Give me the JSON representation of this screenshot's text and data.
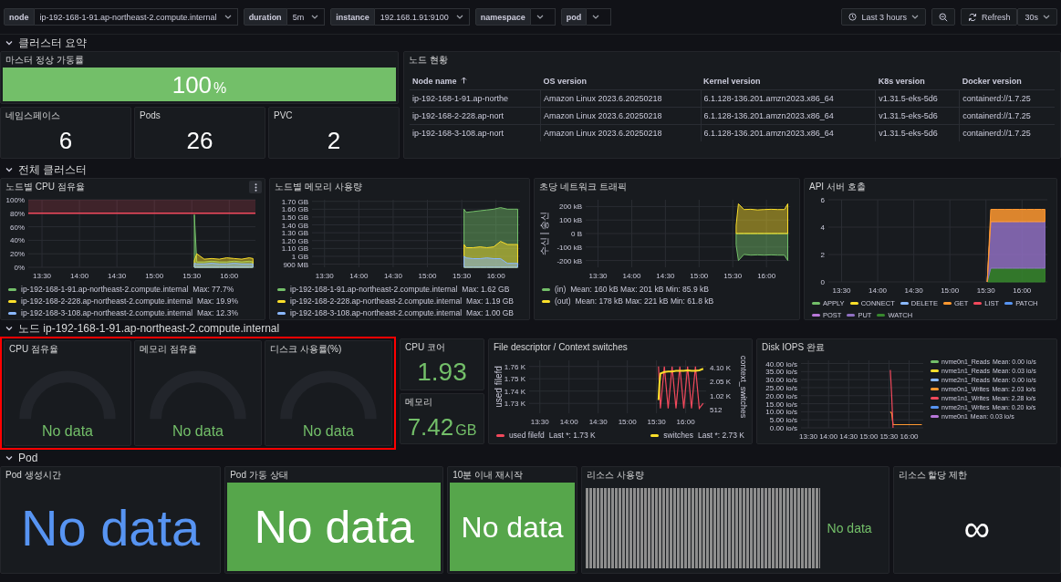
{
  "toolbar": {
    "variables": [
      {
        "label": "node",
        "value": "ip-192-168-1-91.ap-northeast-2.compute.internal"
      },
      {
        "label": "duration",
        "value": "5m"
      },
      {
        "label": "instance",
        "value": "192.168.1.91:9100"
      },
      {
        "label": "namespace"
      },
      {
        "label": "pod"
      }
    ],
    "time_range": "Last 3 hours",
    "refresh": "Refresh",
    "refresh_interval": "30s"
  },
  "rows": [
    {
      "title": "클러스터 요약",
      "expanded": true,
      "panels": [
        {
          "kind": "stat",
          "title": "마스터 정상 가동률",
          "value": "100",
          "unit": "%",
          "background": true,
          "color": "#73bf69"
        },
        {
          "kind": "stat",
          "title": "네임스페이스",
          "value": "6",
          "background": false,
          "color": "#ffffff"
        },
        {
          "kind": "stat",
          "title": "Pods",
          "value": "26",
          "background": false,
          "color": "#ffffff"
        },
        {
          "kind": "stat",
          "title": "PVC",
          "value": "2",
          "background": false,
          "color": "#ffffff"
        },
        {
          "kind": "table",
          "title": "노드 현황",
          "columns": [
            {
              "label": "Node name",
              "sort_ascending": true
            },
            {
              "label": "OS version",
              "sort_ascending": false
            },
            {
              "label": "Kernel version",
              "sort_ascending": false
            },
            {
              "label": "K8s version",
              "sort_ascending": false
            },
            {
              "label": "Docker version",
              "sort_ascending": false
            }
          ],
          "rows": [
            [
              "ip-192-168-1-91.ap-northe",
              "Amazon Linux 2023.6.20250218",
              "6.1.128-136.201.amzn2023.x86_64",
              "v1.31.5-eks-5d6",
              "containerd://1.7.25"
            ],
            [
              "ip-192-168-2-228.ap-nort",
              "Amazon Linux 2023.6.20250218",
              "6.1.128-136.201.amzn2023.x86_64",
              "v1.31.5-eks-5d6",
              "containerd://1.7.25"
            ],
            [
              "ip-192-168-3-108.ap-nort",
              "Amazon Linux 2023.6.20250218",
              "6.1.128-136.201.amzn2023.x86_64",
              "v1.31.5-eks-5d6",
              "containerd://1.7.25"
            ]
          ]
        }
      ]
    },
    {
      "title": "전체 클러스터",
      "expanded": true,
      "panels": [
        {
          "kind": "timeseries",
          "title": "노드별 CPU 점유율",
          "menu": true,
          "legend_stats": [
            "Max: 77.7%",
            "Max: 19.9%",
            "Max: 12.3%"
          ],
          "chart_data": {
            "type": "area",
            "grid": true,
            "x": [
              932,
              934,
              940,
              946,
              952,
              958,
              964,
              970,
              976,
              979
            ],
            "xlim": [
              799,
              981
            ],
            "ylim": [
              0,
              100
            ],
            "xticks": [
              {
                "value": 810,
                "label": "13:30"
              },
              {
                "value": 840,
                "label": "14:00"
              },
              {
                "value": 870,
                "label": "14:30"
              },
              {
                "value": 900,
                "label": "15:00"
              },
              {
                "value": 930,
                "label": "15:30"
              },
              {
                "value": 960,
                "label": "16:00"
              }
            ],
            "yticks": [
              {
                "value": 0,
                "label": "0%"
              },
              {
                "value": 20,
                "label": "20%"
              },
              {
                "value": 40,
                "label": "40%"
              },
              {
                "value": 60,
                "label": "60%"
              },
              {
                "value": 80,
                "label": "80%"
              },
              {
                "value": 100,
                "label": "100%"
              }
            ],
            "ref_lines": [
              {
                "axis": "y",
                "value": 80,
                "color": "#f2495c"
              }
            ],
            "bands": [
              {
                "axis": "y",
                "from": 80,
                "to": 100,
                "color": "#f2495c"
              }
            ],
            "series": [
              {
                "name": "ip-192-168-1-91.ap-northeast-2.compute.internal",
                "color": "#73bf69",
                "values": [
                  78,
                  8,
                  8,
                  9,
                  8,
                  8,
                  9,
                  8,
                  9,
                  8
                ]
              },
              {
                "name": "ip-192-168-2-228.ap-northeast-2.compute.internal",
                "color": "#fade2a",
                "values": [
                  10,
                  20,
                  12,
                  13,
                  12,
                  14,
                  13,
                  12,
                  14,
                  13
                ]
              },
              {
                "name": "ip-192-168-3-108.ap-northeast-2.compute.internal",
                "color": "#8ab8ff",
                "values": [
                  6,
                  5,
                  5,
                  6,
                  5,
                  5,
                  6,
                  5,
                  5,
                  5
                ]
              }
            ]
          }
        },
        {
          "kind": "timeseries",
          "title": "노드별 메모리 사용량",
          "legend_stats": [
            "Max: 1.62 GB",
            "Max: 1.19 GB",
            "Max: 1.00 GB"
          ],
          "lower_tick_label": "900 MB",
          "chart_data": {
            "type": "area",
            "grid": true,
            "x": [
              932,
              934,
              940,
              946,
              952,
              958,
              964,
              970,
              976,
              979
            ],
            "xlim": [
              799,
              981
            ],
            "ylim": [
              0.86,
              1.72
            ],
            "xticks": [
              {
                "value": 810,
                "label": "13:30"
              },
              {
                "value": 840,
                "label": "14:00"
              },
              {
                "value": 870,
                "label": "14:30"
              },
              {
                "value": 900,
                "label": "15:00"
              },
              {
                "value": 930,
                "label": "15:30"
              },
              {
                "value": 960,
                "label": "16:00"
              }
            ],
            "yticks": [
              {
                "value": 1.0,
                "label": "1 GB"
              },
              {
                "value": 1.1,
                "label": "1.10 GB"
              },
              {
                "value": 1.2,
                "label": "1.20 GB"
              },
              {
                "value": 1.3,
                "label": "1.30 GB"
              },
              {
                "value": 1.4,
                "label": "1.40 GB"
              },
              {
                "value": 1.5,
                "label": "1.50 GB"
              },
              {
                "value": 1.6,
                "label": "1.60 GB"
              },
              {
                "value": 1.7,
                "label": "1.70 GB"
              }
            ],
            "series": [
              {
                "name": "ip-192-168-1-91.ap-northeast-2.compute.internal",
                "color": "#73bf69",
                "values": [
                  1.6,
                  1.56,
                  1.57,
                  1.58,
                  1.59,
                  1.6,
                  1.62,
                  1.6,
                  1.6,
                  1.6
                ]
              },
              {
                "name": "ip-192-168-2-228.ap-northeast-2.compute.internal",
                "color": "#fade2a",
                "values": [
                  1.15,
                  1.11,
                  1.11,
                  1.12,
                  1.11,
                  1.12,
                  1.19,
                  1.15,
                  1.15,
                  1.15
                ]
              },
              {
                "name": "ip-192-168-3-108.ap-northeast-2.compute.internal",
                "color": "#8ab8ff",
                "values": [
                  1.0,
                  0.98,
                  0.97,
                  0.97,
                  0.98,
                  0.97,
                  0.97,
                  0.91,
                  0.91,
                  0.91
                ]
              }
            ]
          }
        },
        {
          "kind": "timeseries",
          "title": "초당 네트워크 트래픽",
          "legend_stats": [
            "Mean: 160 kB  Max: 201 kB  Min: 85.9 kB",
            "Mean: 178 kB  Max: 221 kB  Min: 61.8 kB"
          ],
          "chart_data": {
            "type": "area",
            "grid": true,
            "ylabel": "수신 | 송신",
            "x": [
              933,
              935,
              940,
              946,
              952,
              958,
              964,
              970,
              976,
              979
            ],
            "xlim": [
              799,
              981
            ],
            "ylim": [
              -250,
              250
            ],
            "xticks": [
              {
                "value": 810,
                "label": "13:30"
              },
              {
                "value": 840,
                "label": "14:00"
              },
              {
                "value": 870,
                "label": "14:30"
              },
              {
                "value": 900,
                "label": "15:00"
              },
              {
                "value": 930,
                "label": "15:30"
              },
              {
                "value": 960,
                "label": "16:00"
              }
            ],
            "yticks": [
              {
                "value": -200,
                "label": "-200 kB"
              },
              {
                "value": -100,
                "label": "-100 kB"
              },
              {
                "value": 0,
                "label": "0 B"
              },
              {
                "value": 100,
                "label": "100 kB"
              },
              {
                "value": 200,
                "label": "200 kB"
              }
            ],
            "series": [
              {
                "name": "(in)",
                "color": "#73bf69",
                "values": [
                  -85,
                  -200,
                  -155,
                  -160,
                  -158,
                  -160,
                  -158,
                  -160,
                  -160,
                  -200
                ]
              },
              {
                "name": "(out)",
                "color": "#fade2a",
                "values": [
                  60,
                  220,
                  178,
                  180,
                  175,
                  178,
                  180,
                  178,
                  178,
                  220
                ]
              }
            ]
          }
        },
        {
          "kind": "timeseries",
          "title": "API 서버 호출",
          "chart_data": {
            "type": "area",
            "grid": true,
            "stacked": true,
            "x": [
              931,
              934,
              940,
              946,
              952,
              958,
              964,
              970,
              976,
              979
            ],
            "xlim": [
              799,
              981
            ],
            "ylim": [
              0,
              6
            ],
            "xticks": [
              {
                "value": 810,
                "label": "13:30"
              },
              {
                "value": 840,
                "label": "14:00"
              },
              {
                "value": 870,
                "label": "14:30"
              },
              {
                "value": 900,
                "label": "15:00"
              },
              {
                "value": 930,
                "label": "15:30"
              },
              {
                "value": 960,
                "label": "16:00"
              }
            ],
            "yticks": [
              {
                "value": 0,
                "label": "0"
              },
              {
                "value": 2,
                "label": "2"
              },
              {
                "value": 4,
                "label": "4"
              },
              {
                "value": 6,
                "label": "6"
              }
            ],
            "series": [
              {
                "name": "WATCH",
                "color": "#37872d",
                "values": [
                  0,
                  1.0,
                  1.0,
                  1.0,
                  1.0,
                  1.0,
                  1.0,
                  1.0,
                  1.0,
                  1.0
                ]
              },
              {
                "name": "PUT",
                "color": "#8f6fc1",
                "values": [
                  0,
                  3.4,
                  3.4,
                  3.4,
                  3.4,
                  3.4,
                  3.4,
                  3.4,
                  3.4,
                  3.4
                ]
              },
              {
                "name": "GET",
                "color": "#ff9830",
                "values": [
                  0,
                  0.9,
                  0.9,
                  0.9,
                  0.9,
                  0.9,
                  0.9,
                  0.9,
                  0.9,
                  0.9
                ]
              },
              {
                "name": "APPLY",
                "color": "#73bf69",
                "values": [
                  null,
                  null,
                  null,
                  null,
                  null,
                  null,
                  null,
                  null,
                  null,
                  null
                ]
              },
              {
                "name": "CONNECT",
                "color": "#fade2a",
                "values": [
                  null,
                  null,
                  null,
                  null,
                  null,
                  null,
                  null,
                  null,
                  null,
                  null
                ]
              },
              {
                "name": "DELETE",
                "color": "#8ab8ff",
                "values": [
                  null,
                  null,
                  null,
                  null,
                  null,
                  null,
                  null,
                  null,
                  null,
                  null
                ]
              },
              {
                "name": "LIST",
                "color": "#f2495c",
                "values": [
                  null,
                  null,
                  null,
                  null,
                  null,
                  null,
                  null,
                  null,
                  null,
                  null
                ]
              },
              {
                "name": "PATCH",
                "color": "#5794f2",
                "values": [
                  null,
                  null,
                  null,
                  null,
                  null,
                  null,
                  null,
                  null,
                  null,
                  null
                ]
              },
              {
                "name": "POST",
                "color": "#b877d9",
                "values": [
                  null,
                  null,
                  null,
                  null,
                  null,
                  null,
                  null,
                  null,
                  null,
                  null
                ]
              }
            ]
          }
        }
      ]
    },
    {
      "title": "노드 ip-192-168-1-91.ap-northeast-2.compute.internal",
      "expanded": true,
      "highlighted": true,
      "panels": [
        {
          "kind": "gauge",
          "title": "CPU 점유율",
          "value": "No data",
          "color": "#73bf69"
        },
        {
          "kind": "gauge",
          "title": "메모리 점유율",
          "value": "No data",
          "color": "#73bf69"
        },
        {
          "kind": "gauge",
          "title": "디스크 사용률(%)",
          "value": "No data",
          "color": "#73bf69"
        },
        {
          "kind": "stat",
          "title": "CPU 코어",
          "value": "1.93",
          "background": false,
          "color": "#73bf69"
        },
        {
          "kind": "stat",
          "title": "메모리",
          "value": "7.42",
          "unit": "GB",
          "background": false,
          "color": "#73bf69"
        },
        {
          "kind": "timeseries",
          "title": "File descriptor / Context switches",
          "legend_stats": [
            "Last *: 1.73 K",
            "Last *: 2.73 K"
          ],
          "right_axis": {
            "title": "context_switches",
            "ticks": [
              "4.10 K",
              "2.05 K",
              "1.02 K",
              "512"
            ]
          },
          "secondary_series": {
            "name": "switches",
            "color": "#fade2a"
          },
          "chart_data": {
            "type": "line",
            "grid": true,
            "ylabel": "used filefd",
            "x": [
              932,
              934,
              938,
              942,
              946,
              950,
              954,
              958,
              962,
              966,
              970,
              974,
              978
            ],
            "xlim": [
              799,
              981
            ],
            "ylim": [
              1.722,
              1.765
            ],
            "xticks": [
              {
                "value": 810,
                "label": "13:30"
              },
              {
                "value": 840,
                "label": "14:00"
              },
              {
                "value": 870,
                "label": "14:30"
              },
              {
                "value": 900,
                "label": "15:00"
              },
              {
                "value": 930,
                "label": "15:30"
              },
              {
                "value": 960,
                "label": "16:00"
              }
            ],
            "yticks": [
              {
                "value": 1.73,
                "label": "1.73 K"
              },
              {
                "value": 1.74,
                "label": "1.74 K"
              },
              {
                "value": 1.75,
                "label": "1.75 K"
              },
              {
                "value": 1.76,
                "label": "1.76 K"
              }
            ],
            "series": [
              {
                "name": "used filefd",
                "color": "#f2495c",
                "values": [
                  1.76,
                  1.726,
                  1.76,
                  1.726,
                  1.76,
                  1.726,
                  1.76,
                  1.726,
                  1.76,
                  1.726,
                  1.76,
                  1.726,
                  1.73
                ]
              }
            ]
          }
        },
        {
          "kind": "timeseries",
          "title": "Disk IOPS 완료",
          "legend_stats": [
            "Mean: 0.00 io/s",
            "Mean: 0.03 io/s",
            "Mean: 0.00 io/s",
            "Mean: 2.03 io/s",
            "Mean: 2.28 io/s",
            "Mean: 0.20 io/s",
            "Mean: 0.03 io/s"
          ],
          "chart_data": {
            "type": "line",
            "grid": true,
            "x": [
              932,
              934,
              936,
              940,
              946,
              952,
              958,
              964,
              970,
              976,
              979
            ],
            "xlim": [
              799,
              981
            ],
            "ylim": [
              0,
              42
            ],
            "xticks": [
              {
                "value": 810,
                "label": "13:30"
              },
              {
                "value": 840,
                "label": "14:00"
              },
              {
                "value": 870,
                "label": "14:30"
              },
              {
                "value": 900,
                "label": "15:00"
              },
              {
                "value": 930,
                "label": "15:30"
              },
              {
                "value": 960,
                "label": "16:00"
              }
            ],
            "yticks": [
              {
                "value": 0,
                "label": "0.00 io/s"
              },
              {
                "value": 5,
                "label": "5.00 io/s"
              },
              {
                "value": 10,
                "label": "10.00 io/s"
              },
              {
                "value": 15,
                "label": "15.00 io/s"
              },
              {
                "value": 20,
                "label": "20.00 io/s"
              },
              {
                "value": 25,
                "label": "25.00 io/s"
              },
              {
                "value": 30,
                "label": "30.00 io/s"
              },
              {
                "value": 35,
                "label": "35.00 io/s"
              },
              {
                "value": 40,
                "label": "40.00 io/s"
              }
            ],
            "series": [
              {
                "name": "nvme0n1_Reads",
                "color": "#73bf69",
                "values": [
                  null,
                  null,
                  null,
                  null,
                  null,
                  null,
                  null,
                  null,
                  null,
                  null,
                  null
                ]
              },
              {
                "name": "nvme1n1_Reads",
                "color": "#fade2a",
                "values": [
                  null,
                  null,
                  null,
                  null,
                  null,
                  null,
                  null,
                  null,
                  null,
                  null,
                  null
                ]
              },
              {
                "name": "nvme2n1_Reads",
                "color": "#8ab8ff",
                "values": [
                  null,
                  null,
                  null,
                  null,
                  null,
                  null,
                  null,
                  null,
                  null,
                  null,
                  null
                ]
              },
              {
                "name": "nvme0n1_Writes",
                "color": "#ff9830",
                "values": [
                  10,
                  9,
                  2,
                  2,
                  2,
                  2,
                  2,
                  2,
                  2,
                  2,
                  2
                ]
              },
              {
                "name": "nvme1n1_Writes",
                "color": "#f2495c",
                "values": [
                  36,
                  20,
                  0,
                  null,
                  null,
                  null,
                  null,
                  null,
                  null,
                  null,
                  null
                ]
              },
              {
                "name": "nvme2n1_Writes",
                "color": "#5794f2",
                "values": [
                  null,
                  null,
                  null,
                  null,
                  null,
                  null,
                  null,
                  null,
                  null,
                  null,
                  null
                ]
              },
              {
                "name": "nvme0n1",
                "color": "#b877d9",
                "values": [
                  null,
                  null,
                  null,
                  null,
                  null,
                  null,
                  null,
                  null,
                  null,
                  null,
                  null
                ]
              }
            ]
          }
        }
      ]
    },
    {
      "title": "Pod",
      "expanded": true,
      "panels": [
        {
          "kind": "stat",
          "title": "Pod 생성시간",
          "value": "No data",
          "background": false,
          "color": "#5794f2"
        },
        {
          "kind": "stat",
          "title": "Pod 가동 상태",
          "value": "No data",
          "background": true,
          "color": "#56a64b"
        },
        {
          "kind": "stat",
          "title": "10분 이내 재시작",
          "value": "No data",
          "background": true,
          "color": "#56a64b"
        },
        {
          "kind": "bargauge",
          "title": "리소스 사용량",
          "value": "No data",
          "color": "#73bf69"
        },
        {
          "kind": "stat",
          "title": "리소스 할당 제한",
          "value": "∞",
          "background": false,
          "color": "#ffffff"
        }
      ]
    }
  ]
}
